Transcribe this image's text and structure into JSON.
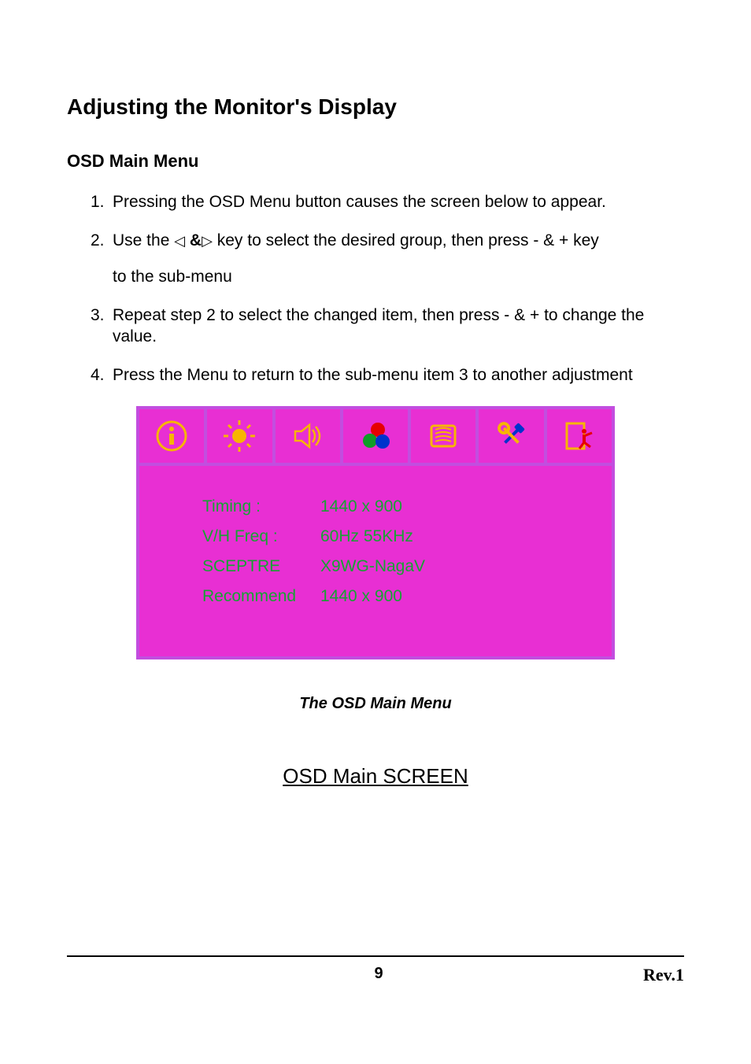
{
  "page": {
    "title": "Adjusting the Monitor's Display",
    "section": "OSD Main Menu",
    "steps": {
      "s1": "Pressing the OSD Menu button causes the screen below to appear.",
      "s2a": "Use the ",
      "s2b": " key to select the desired group, then press - & + key",
      "s2sub": "to the sub-menu",
      "s3": "Repeat step 2 to select the changed item, then press - & + to change the value.",
      "s4": "Press the Menu to return to the sub-menu item 3 to another adjustment"
    },
    "caption": "The OSD Main Menu",
    "screen_title": "OSD Main SCREEN",
    "page_number": "9",
    "revision": "Rev.1"
  },
  "osd": {
    "tabs": [
      {
        "name": "info-icon"
      },
      {
        "name": "brightness-icon"
      },
      {
        "name": "volume-icon"
      },
      {
        "name": "color-icon"
      },
      {
        "name": "geometry-icon"
      },
      {
        "name": "tools-icon"
      },
      {
        "name": "exit-icon"
      }
    ],
    "rows": [
      {
        "label": "Timing :",
        "value": "1440 x 900"
      },
      {
        "label": "V/H Freq :",
        "value": "60Hz  55KHz"
      },
      {
        "label": "SCEPTRE",
        "value": "X9WG-NagaV"
      },
      {
        "label": "Recommend",
        "value": "1440 x 900"
      }
    ]
  }
}
